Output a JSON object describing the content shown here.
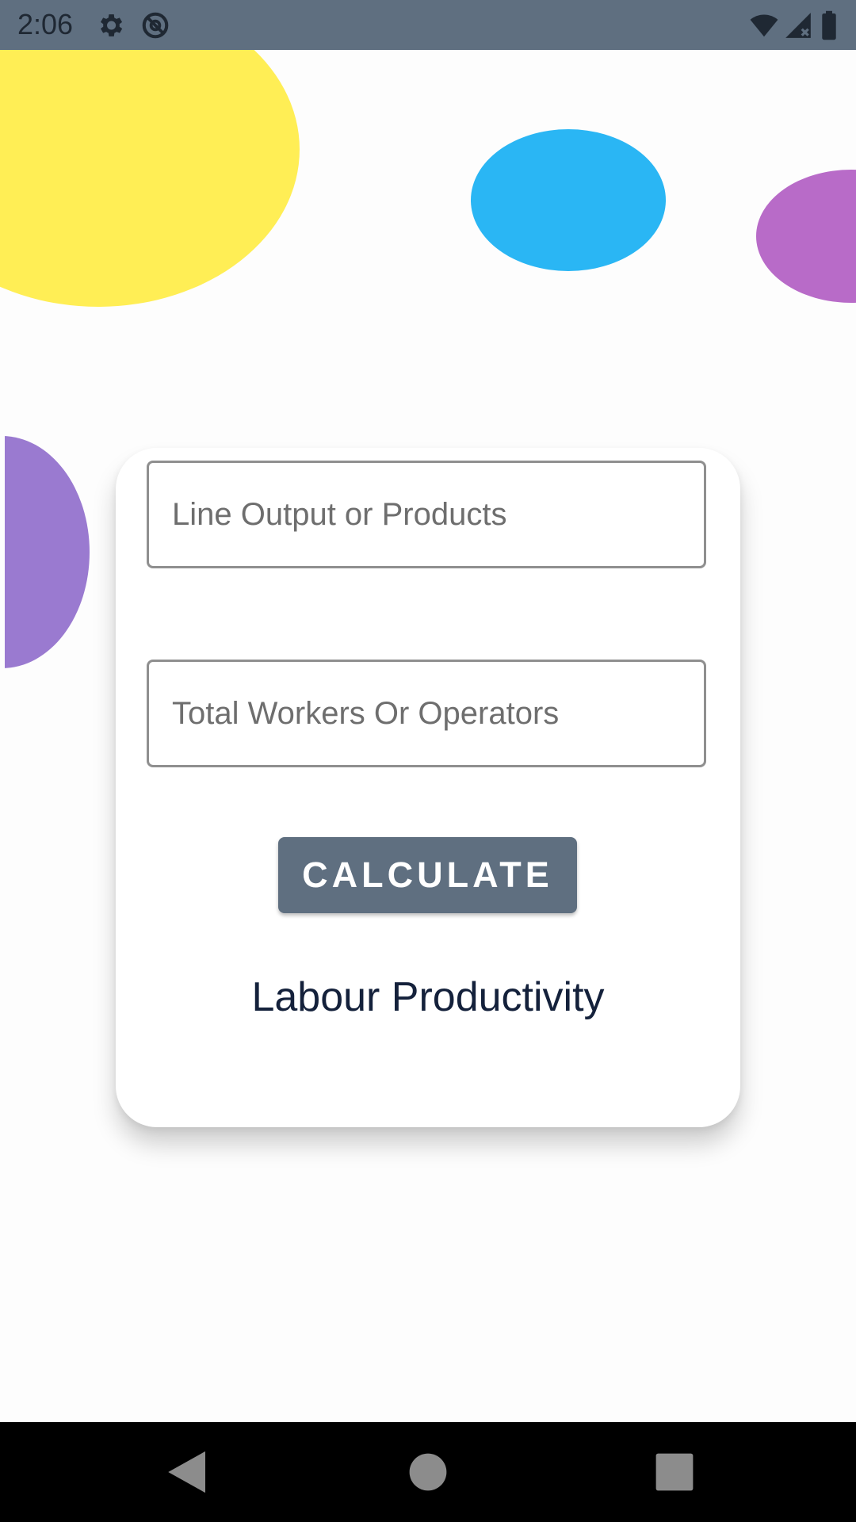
{
  "status_bar": {
    "time": "2:06",
    "icons": [
      "gear-icon",
      "at-sign-icon",
      "wifi-icon",
      "cell-signal-icon",
      "battery-icon"
    ]
  },
  "form": {
    "output_placeholder": "Line Output or Products",
    "output_value": "",
    "workers_placeholder": "Total Workers Or Operators",
    "workers_value": "",
    "calculate_label": "CALCULATE",
    "result_label": "Labour Productivity"
  },
  "nav_bar": {
    "buttons": [
      "back-icon",
      "home-icon",
      "recents-icon"
    ]
  },
  "colors": {
    "status_bar": "#5f6f80",
    "button": "#5f6f80",
    "blob_yellow": "#ffee55",
    "blob_blue": "#2ab6f4",
    "blob_magenta": "#b86bc8",
    "blob_purple": "#9a7ad0",
    "result_text": "#14213b"
  }
}
